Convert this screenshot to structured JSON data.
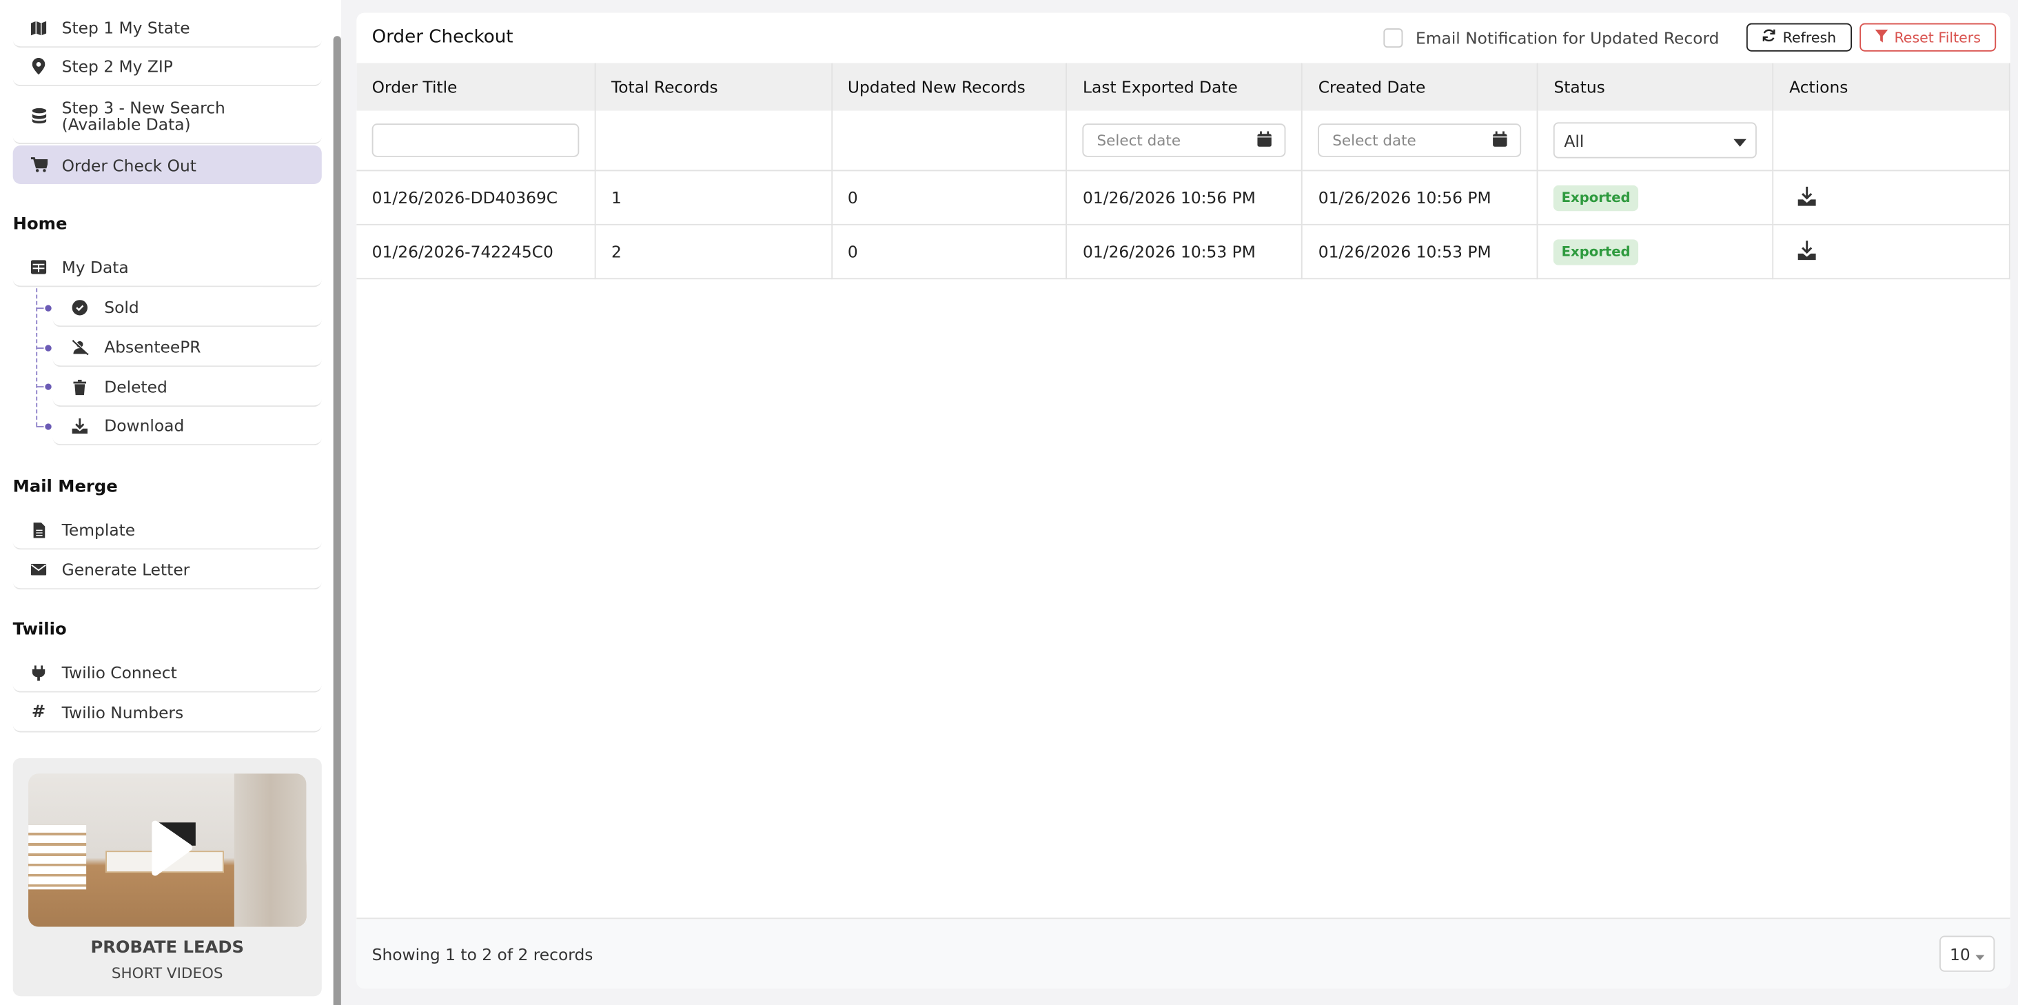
{
  "sidebar": {
    "steps": [
      {
        "label": "Step 1 My State",
        "icon": "map-icon"
      },
      {
        "label": "Step 2 My ZIP",
        "icon": "map-pin-icon"
      },
      {
        "label": "Step 3 - New Search (Available Data)",
        "icon": "database-icon"
      },
      {
        "label": "Order Check Out",
        "icon": "cart-icon",
        "active": true
      }
    ],
    "home": {
      "heading": "Home",
      "my_data": "My Data",
      "children": [
        "Sold",
        "AbsenteePR",
        "Deleted",
        "Download"
      ]
    },
    "mail_merge": {
      "heading": "Mail Merge",
      "items": [
        "Template",
        "Generate Letter"
      ]
    },
    "twilio": {
      "heading": "Twilio",
      "items": [
        "Twilio Connect",
        "Twilio Numbers"
      ]
    },
    "video": {
      "title": "PROBATE LEADS",
      "subtitle": "SHORT VIDEOS"
    }
  },
  "main": {
    "title": "Order Checkout",
    "email_notification_label": "Email Notification for Updated Record",
    "refresh_label": "Refresh",
    "reset_filters_label": "Reset Filters",
    "columns": [
      "Order Title",
      "Total Records",
      "Updated New Records",
      "Last Exported Date",
      "Created Date",
      "Status",
      "Actions"
    ],
    "filters": {
      "date_placeholder": "Select date",
      "status_value": "All"
    },
    "rows": [
      {
        "order_title": "01/26/2026-DD40369C",
        "total": "1",
        "updated": "0",
        "last_exported": "01/26/2026 10:56 PM",
        "created": "01/26/2026 10:56 PM",
        "status": "Exported"
      },
      {
        "order_title": "01/26/2026-742245C0",
        "total": "2",
        "updated": "0",
        "last_exported": "01/26/2026 10:53 PM",
        "created": "01/26/2026 10:53 PM",
        "status": "Exported"
      }
    ],
    "footer": {
      "showing": "Showing 1 to 2 of 2 records",
      "page_size": "10"
    }
  },
  "colors": {
    "active_bg": "#dedbee",
    "accent": "#6b5bb5",
    "danger": "#d9534f",
    "success": "#2e9a3e"
  }
}
